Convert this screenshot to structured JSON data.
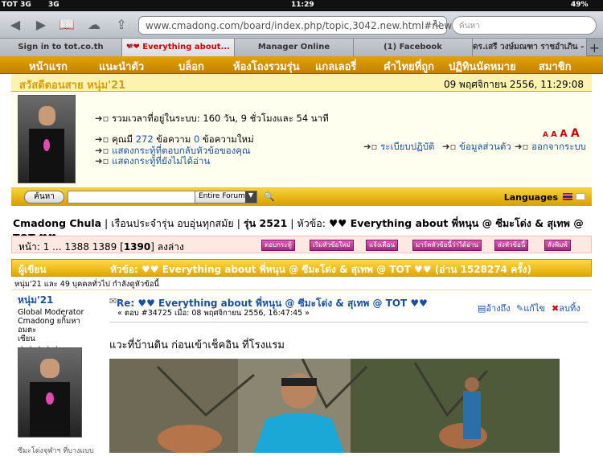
{
  "status": {
    "carrier": "TOT 3G",
    "network": "3G",
    "time": "11:29",
    "battery": "49%"
  },
  "browser": {
    "url": "www.cmadong.com/board/index.php/topic,3042.new.html#new",
    "search_placeholder": "ค้นหา"
  },
  "tabs": [
    {
      "label": "Sign in to tot.co.th"
    },
    {
      "label": "❤❤ Everything about..."
    },
    {
      "label": "Manager Online"
    },
    {
      "label": "(1) Facebook"
    },
    {
      "label": "ดร.เสรี วงษ์มณฑา ราชอำเภิน - ค้น..."
    }
  ],
  "nav": [
    "หน้าแรก",
    "แนะนำตัว",
    "บล็อก",
    "ห้องโถงรวมรุ่น",
    "แกลเลอรี่",
    "คำไทยที่ถูก",
    "ปฏิทินนัดหมาย",
    "สมาชิก"
  ],
  "greeting": {
    "left": "สวัสดีตอนสาย หนุ่ม'21",
    "right": "09 พฤศจิกายน 2556, 11:29:08"
  },
  "user": {
    "online_time": "รวมเวลาที่อยู่ในระบบ: 160 วัน, 9 ชั่วโมงและ 54 นาที",
    "msg_prefix": "คุณมี ",
    "msg_count": "272",
    "msg_mid": " ข้อความ ",
    "msg_new": "0",
    "msg_suffix": " ข้อความใหม่",
    "link_replies": "แสดงกระทู้ที่ตอบกลับหัวข้อของคุณ",
    "link_unread": "แสดงกระทู้ที่ยังไม่ได้อ่าน",
    "link_rules": "ระเบียบปฏิบัติ",
    "link_profile": "ข้อมูลส่วนตัว",
    "link_logout": "ออกจากระบบ",
    "font_sizes": "A A A A"
  },
  "search": {
    "button": "ค้นหา",
    "scope": "Entire Forum",
    "languages": "Languages"
  },
  "breadcrumb": {
    "site": "Cmadong Chula",
    "sep": " | ",
    "board": "เรือนประจำรุ่น อบอุ่นทุกสมัย",
    "sep2": " | ",
    "class": "รุ่น 2521",
    "sep3": " | ",
    "topic_label": "หัวข้อ: ",
    "topic": "♥♥ Everything about พี่หนุน @ ซีมะโด่ง & สุเทพ @ TOT ♥♥"
  },
  "pagination": {
    "text": "หน้า: 1 ... 1388 1389 [",
    "current": "1390",
    "text2": "]   ลงล่าง"
  },
  "actions": [
    "ตอบกระทู้",
    "เริ่มหัวข้อใหม่",
    "แจ้งเตือน",
    "มาร์คหัวข้อนี้ว่าได้อ่าน",
    "ส่งหัวข้อนี้",
    "สั่งพิมพ์"
  ],
  "thread_header": {
    "author": "ผู้เขียน",
    "topic": "หัวข้อ: ♥♥ Everything about พี่หนุน @ ซีมะโด่ง & สุเทพ @ TOT ♥♥  (อ่าน 1528274 ครั้ง)"
  },
  "viewers": "หนุ่ม'21 และ 49 บุคคลทั่วไป กำลังดูหัวข้อนี้",
  "post": {
    "author": "หนุ่ม'21",
    "role": "Global Moderator",
    "role2": "Cmadong ยกิ้มหาอมตะ",
    "role3": "เซียน",
    "stars": "★★★★★",
    "title": "Re: ♥♥ Everything about พี่หนุน @ ซีมะโด่ง & สุเทพ @ TOT ♥♥",
    "meta": "« ตอบ #34725 เมื่อ: 08 พฤศจิกายน 2556, 16:47:45 »",
    "quote": "อ้างถึง",
    "edit": "แก้ไข",
    "delete": "ลบทิ้ง",
    "body": "แวะที่บ้านดิน ก่อนเข้าเช็คอิน ที่โรงแรม",
    "signature": "ซีมะโด่งจุฬาฯ ที่บางแบบ"
  },
  "colors": {
    "gold": "#e0a400",
    "pink": "#c73a95",
    "blue": "#1a4fa0"
  }
}
